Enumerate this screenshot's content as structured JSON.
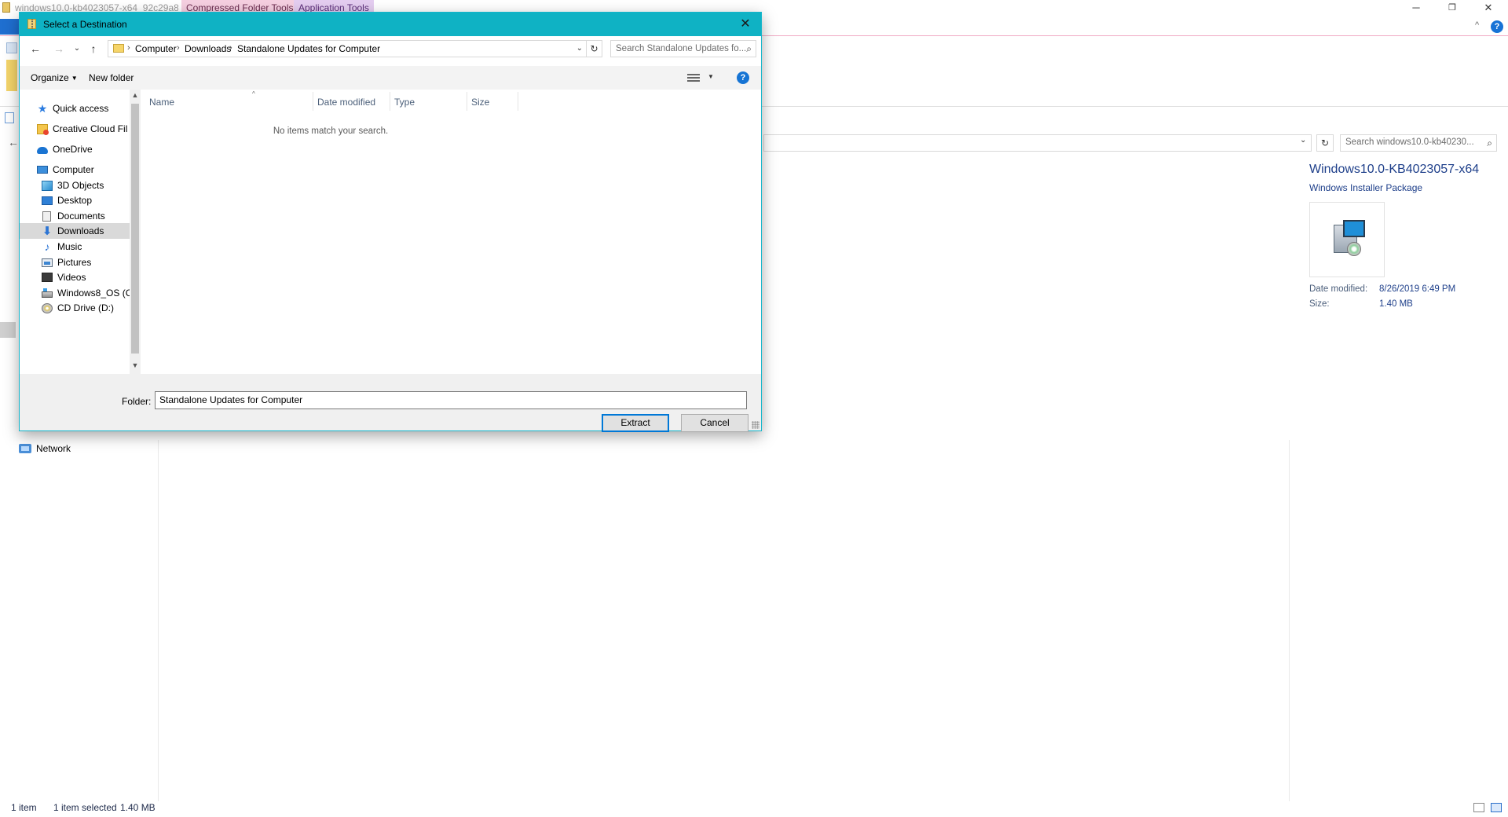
{
  "background": {
    "window_title": "windows10.0-kb4023057-x64_92c29a8...",
    "context_tabs": [
      "Compressed Folder Tools",
      "Application Tools"
    ],
    "window_controls": {
      "minimize": "─",
      "restore": "❐",
      "close": "✕"
    },
    "help_glyph": "?",
    "search_placeholder": "Search windows10.0-kb40230...",
    "nav_pane": {
      "network_label": "Network"
    },
    "preview": {
      "title": "Windows10.0-KB4023057-x64",
      "type": "Windows Installer Package",
      "date_modified_label": "Date modified:",
      "date_modified_value": "8/26/2019 6:49 PM",
      "size_label": "Size:",
      "size_value": "1.40 MB"
    },
    "status_bar": {
      "item_count": "1 item",
      "selection": "1 item selected",
      "selection_size": "1.40 MB"
    }
  },
  "dialog": {
    "title": "Select a Destination",
    "close_glyph": "✕",
    "nav": {
      "back": "←",
      "forward": "→",
      "recent": "⌄",
      "up": "↑",
      "refresh": "↻"
    },
    "breadcrumb": [
      "Computer",
      "Downloads",
      "Standalone Updates for Computer"
    ],
    "breadcrumb_separator": "›",
    "search_placeholder": "Search Standalone Updates fo...",
    "toolbar": {
      "organize": "Organize",
      "new_folder": "New folder",
      "help": "?"
    },
    "nav_pane": {
      "items": [
        {
          "label": "Quick access",
          "icon": "star-icon"
        },
        {
          "label": "Creative Cloud Fil",
          "icon": "creative-cloud-folder-icon"
        },
        {
          "label": "OneDrive",
          "icon": "cloud-icon"
        },
        {
          "label": "Computer",
          "icon": "computer-icon"
        },
        {
          "label": "3D Objects",
          "icon": "cube-icon"
        },
        {
          "label": "Desktop",
          "icon": "desktop-icon"
        },
        {
          "label": "Documents",
          "icon": "documents-icon"
        },
        {
          "label": "Downloads",
          "icon": "downloads-icon",
          "selected": true
        },
        {
          "label": "Music",
          "icon": "music-icon"
        },
        {
          "label": "Pictures",
          "icon": "pictures-icon"
        },
        {
          "label": "Videos",
          "icon": "videos-icon"
        },
        {
          "label": "Windows8_OS (C",
          "icon": "drive-icon"
        },
        {
          "label": "CD Drive (D:)",
          "icon": "cd-drive-icon"
        }
      ]
    },
    "file_list": {
      "columns": [
        "Name",
        "Date modified",
        "Type",
        "Size"
      ],
      "empty_message": "No items match your search."
    },
    "folder_label": "Folder:",
    "folder_value": "Standalone Updates for Computer",
    "buttons": {
      "extract": "Extract",
      "cancel": "Cancel"
    },
    "colors": {
      "title_bar": "#0fb2c4",
      "accent": "#0078d7"
    }
  }
}
